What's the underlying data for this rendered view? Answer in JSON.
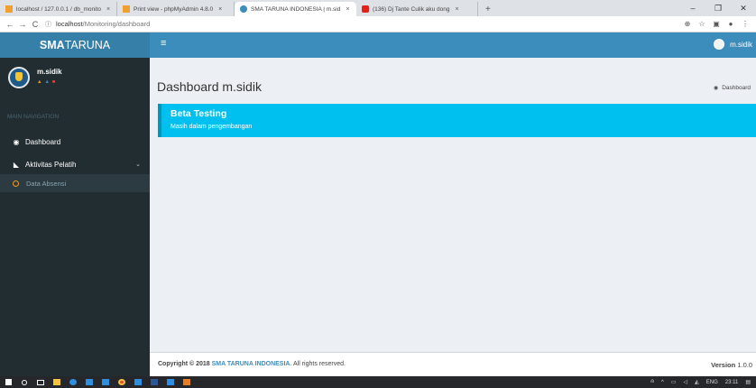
{
  "browser": {
    "tabs": [
      {
        "title": "localhost / 127.0.0.1 / db_monito",
        "close": "×",
        "icon_color": "#f0a030"
      },
      {
        "title": "Print view - phpMyAdmin 4.8.0",
        "close": "×",
        "icon_color": "#f0a030"
      },
      {
        "title": "SMA TARUNA INDONESIA | m.sid",
        "close": "×",
        "icon_color": "#3c8dbc"
      },
      {
        "title": "(136) Dj Tante Culik aku dong",
        "close": "×",
        "icon_color": "#e62117"
      }
    ],
    "new_tab": "+",
    "window_controls": {
      "minimize": "–",
      "maximize": "❐",
      "close": "✕"
    },
    "back": "←",
    "forward": "→",
    "reload": "C",
    "info_icon": "ⓘ",
    "url_host": "localhost",
    "url_path": "/Monitoring/dashboard",
    "toolbar_icons": [
      "⊕",
      "☆",
      "▣",
      "●",
      "⋮"
    ]
  },
  "app": {
    "logo_bold": "SMA",
    "logo_rest": "TARUNA",
    "toggle": "≡",
    "user_name": "m.sidik"
  },
  "sidebar": {
    "user_name": "m.sidik",
    "status_dots": [
      {
        "glyph": "▲",
        "color": "#f39c12"
      },
      {
        "glyph": "▲",
        "color": "#3c8dbc"
      },
      {
        "glyph": "■",
        "color": "#dd4b39"
      }
    ],
    "header": "MAIN NAVIGATION",
    "items": [
      {
        "label": "Dashboard",
        "icon": "dashboard-icon",
        "glyph": "◉"
      },
      {
        "label": "Aktivitas Pelatih",
        "icon": "bullhorn-icon",
        "glyph": "◣",
        "chevron": "⌄"
      }
    ],
    "submenu": [
      {
        "label": "Data Absensi"
      }
    ]
  },
  "content": {
    "title": "Dashboard m.sidik",
    "breadcrumb": "Dashboard",
    "callout_title": "Beta Testing",
    "callout_text": "Masih dalam pengembangan"
  },
  "footer": {
    "copyright_prefix": "Copyright © 2018 ",
    "org": "SMA TARUNA INDONESIA",
    "suffix": ". All rights reserved.",
    "version_label": "Version",
    "version": "1.0.0"
  },
  "taskbar": {
    "icons": [
      {
        "name": "windows-start-icon",
        "color": "#ffffff"
      },
      {
        "name": "search-icon",
        "color": "#ffffff"
      },
      {
        "name": "task-view-icon",
        "color": "#ffffff"
      },
      {
        "name": "file-explorer-icon",
        "color": "#f4c43d"
      },
      {
        "name": "edge-icon",
        "color": "#2f8ee0"
      },
      {
        "name": "store-icon",
        "color": "#2f8ee0"
      },
      {
        "name": "mail-icon",
        "color": "#2f8ee0"
      },
      {
        "name": "chrome-icon",
        "color": "#e8453c"
      },
      {
        "name": "app-icon",
        "color": "#2f8ee0"
      },
      {
        "name": "word-icon",
        "color": "#2b5797"
      },
      {
        "name": "vscode-icon",
        "color": "#2f8ee0"
      },
      {
        "name": "app2-icon",
        "color": "#e67e22"
      }
    ],
    "tray": {
      "people": "⍝",
      "chevron": "^",
      "battery": "▭",
      "volume": "◁",
      "network": "◭",
      "lang": "ENG",
      "time": "23:11",
      "notification": "▤"
    }
  },
  "colors": {
    "primary": "#3c8dbc",
    "logo_bg": "#367fa9",
    "sidebar_bg": "#222d32",
    "callout": "#00c0ef",
    "accent_ring": "#f39c12"
  }
}
